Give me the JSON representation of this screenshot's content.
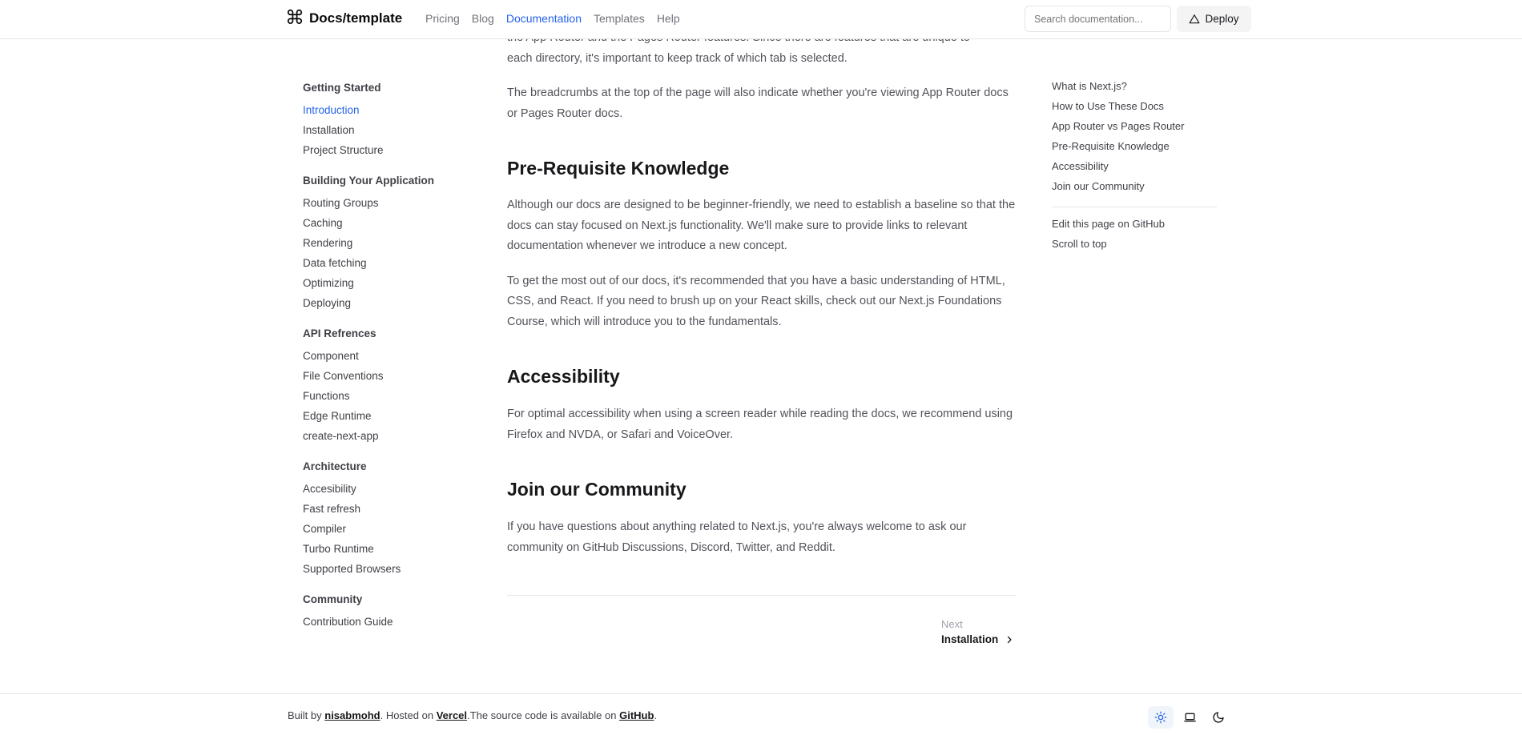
{
  "header": {
    "brand": "Docs/template",
    "nav": [
      "Pricing",
      "Blog",
      "Documentation",
      "Templates",
      "Help"
    ],
    "search_placeholder": "Search documentation...",
    "deploy_label": "Deploy"
  },
  "sidebar": {
    "groups": [
      {
        "heading": "Getting Started",
        "items": [
          "Introduction",
          "Installation",
          "Project Structure"
        ]
      },
      {
        "heading": "Building Your Application",
        "items": [
          "Routing Groups",
          "Caching",
          "Rendering",
          "Data fetching",
          "Optimizing",
          "Deploying"
        ]
      },
      {
        "heading": "API Refrences",
        "items": [
          "Component",
          "File Conventions",
          "Functions",
          "Edge Runtime",
          "create-next-app"
        ]
      },
      {
        "heading": "Architecture",
        "items": [
          "Accesibility",
          "Fast refresh",
          "Compiler",
          "Turbo Runtime",
          "Supported Browsers"
        ]
      },
      {
        "heading": "Community",
        "items": [
          "Contribution Guide"
        ]
      }
    ]
  },
  "main": {
    "p_top_1": "the App Router and the Pages Router features. Since there are features that are unique to",
    "p_top_2": "each directory, it's important to keep track of which tab is selected.",
    "p_breadcrumbs": "The breadcrumbs at the top of the page will also indicate whether you're viewing App Router docs or Pages Router docs.",
    "h_prereq": "Pre-Requisite Knowledge",
    "p_prereq_1": "Although our docs are designed to be beginner-friendly, we need to establish a baseline so that the docs can stay focused on Next.js functionality. We'll make sure to provide links to relevant documentation whenever we introduce a new concept.",
    "p_prereq_2": "To get the most out of our docs, it's recommended that you have a basic understanding of HTML, CSS, and React. If you need to brush up on your React skills, check out our Next.js Foundations Course, which will introduce you to the fundamentals.",
    "h_access": "Accessibility",
    "p_access": "For optimal accessibility when using a screen reader while reading the docs, we recommend using Firefox and NVDA, or Safari and VoiceOver.",
    "h_community": "Join our Community",
    "p_community": "If you have questions about anything related to Next.js, you're always welcome to ask our community on GitHub Discussions, Discord, Twitter, and Reddit.",
    "next_label": "Next",
    "next_title": "Installation"
  },
  "toc": {
    "items": [
      "What is Next.js?",
      "How to Use These Docs",
      "App Router vs Pages Router",
      "Pre-Requisite Knowledge",
      "Accessibility",
      "Join our Community"
    ],
    "edit": "Edit this page on GitHub",
    "scroll": "Scroll to top"
  },
  "footer": {
    "built_by": "Built by ",
    "author": "nisabmohd",
    "hosted_on": ". Hosted on ",
    "host": "Vercel",
    "source_text": ".The source code is available on ",
    "repo": "GitHub",
    "end": "."
  },
  "colors": {
    "accent": "#2563eb",
    "text": "#3f3f46",
    "heading": "#18181b",
    "border": "#e4e4e7"
  }
}
